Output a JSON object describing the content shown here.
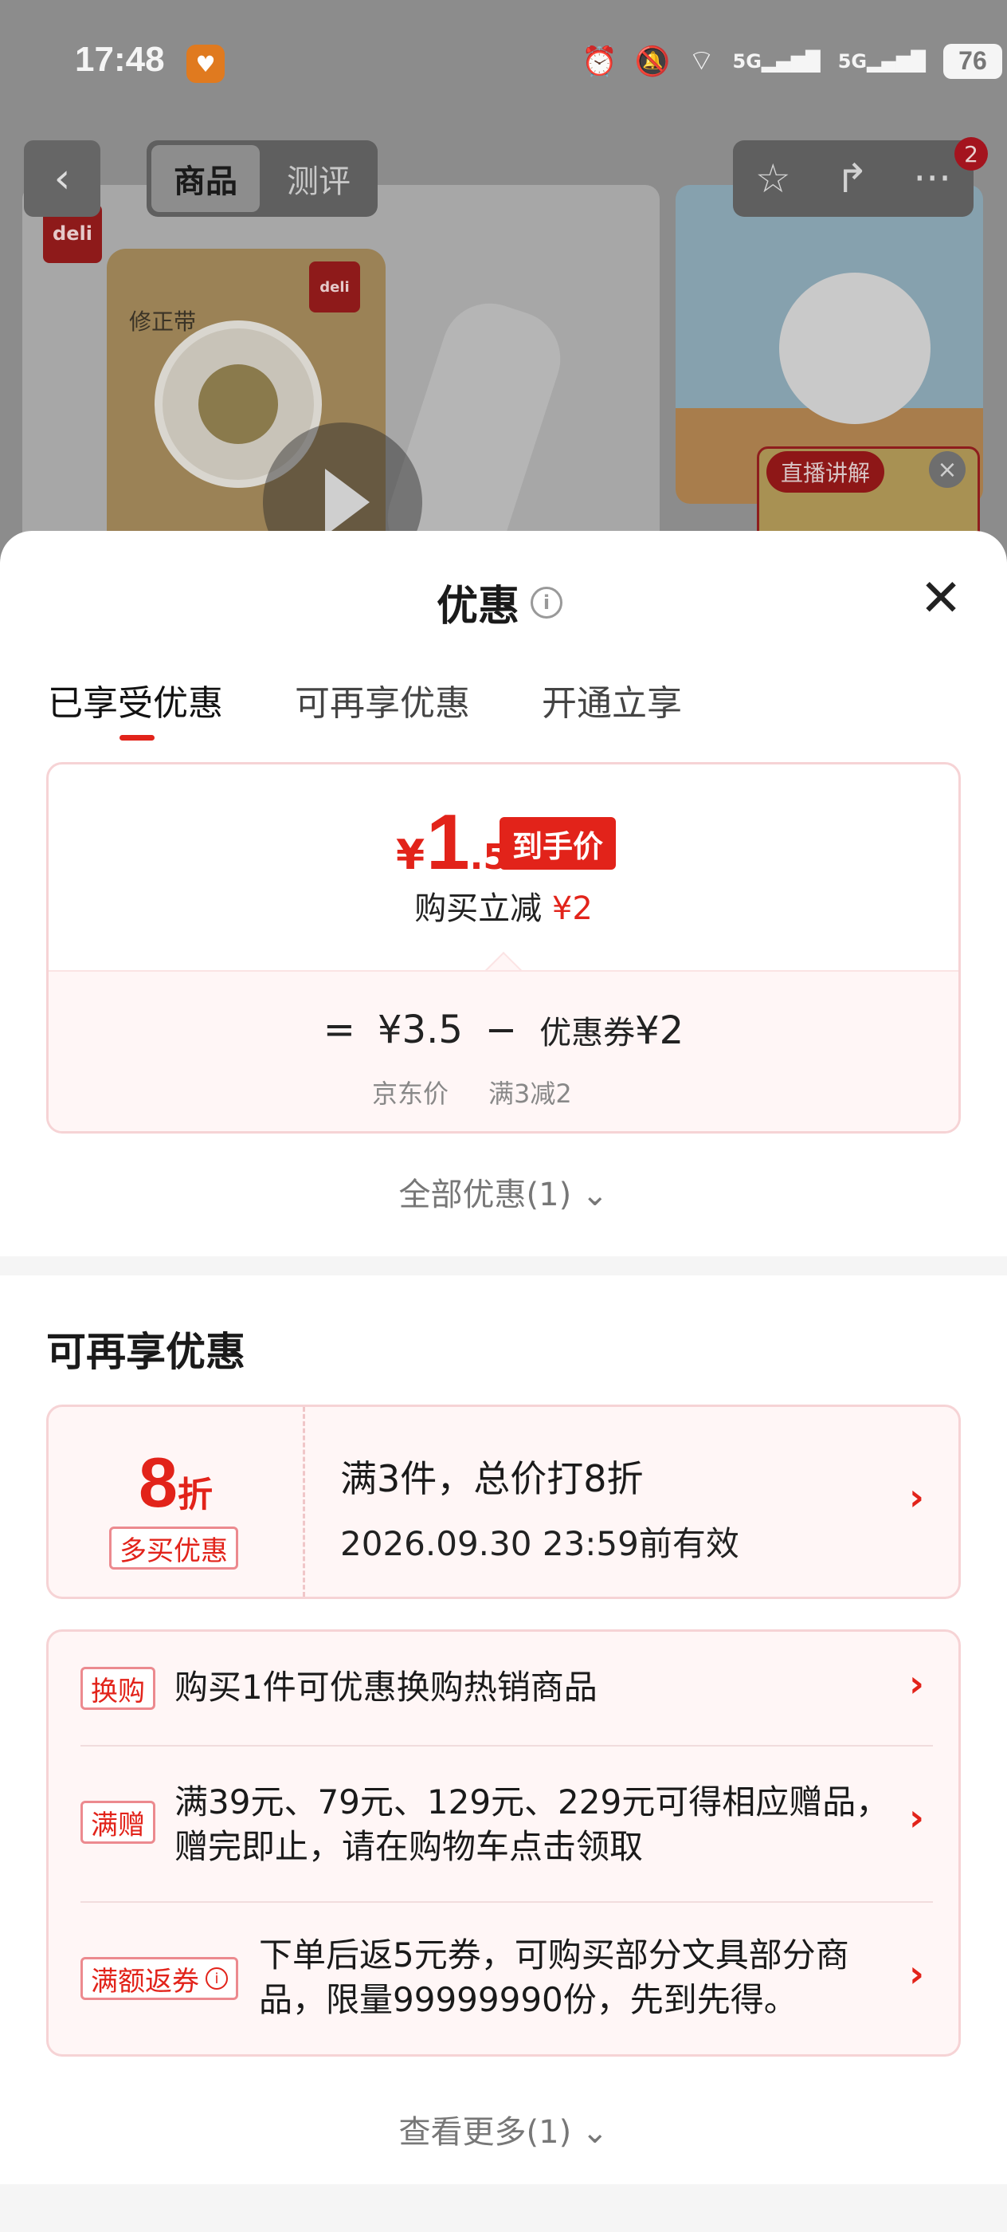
{
  "status_bar": {
    "time": "17:48",
    "battery": "76",
    "net1": "5G",
    "net2": "5G"
  },
  "nav": {
    "tabs": [
      "商品",
      "测评"
    ],
    "badge_count": "2"
  },
  "product": {
    "brand_logo": "deli",
    "pack_label": "修正带",
    "live_badge": "直播讲解"
  },
  "sheet": {
    "title": "优惠",
    "tabs": [
      "已享受优惠",
      "可再享优惠",
      "开通立享"
    ],
    "enjoyed": {
      "currency": "¥",
      "price_int": "1",
      "price_dec": ".5",
      "price_tag": "到手价",
      "discount_text": "购买立减",
      "discount_amount": "¥2",
      "eq": "=",
      "jd_price": "¥3.5",
      "minus": "−",
      "coupon_label": "优惠券",
      "coupon_amount": "¥2",
      "jd_price_label": "京东价",
      "coupon_rule": "满3减2"
    },
    "all_discount": "全部优惠(1)",
    "more_section_title": "可再享优惠",
    "promo": {
      "rate": "8",
      "rate_unit": "折",
      "tag": "多买优惠",
      "title": "满3件，总价打8折",
      "valid_until": "2026.09.30 23:59前有效"
    },
    "list": [
      {
        "tag": "换购",
        "text": "购买1件可优惠换购热销商品"
      },
      {
        "tag": "满赠",
        "line1": "满39元、79元、129元、229元可得相应赠品，",
        "line2": "赠完即止，请在购物车点击领取"
      },
      {
        "tag": "满额返券",
        "line1": "下单后返5元券，可购买部分文具部分商",
        "line2": "品，限量99999990份，先到先得。"
      }
    ],
    "see_more": "查看更多(1)"
  },
  "colors": {
    "accent": "#e2231a",
    "card_bg": "#fff6f6",
    "card_border": "#f6d3d5"
  },
  "icons": [
    "back-icon",
    "star-icon",
    "share-icon",
    "more-icon",
    "close-icon",
    "info-icon",
    "chevron-down-icon",
    "chevron-right-icon",
    "play-icon",
    "alarm-icon",
    "mute-icon",
    "wifi-icon"
  ]
}
